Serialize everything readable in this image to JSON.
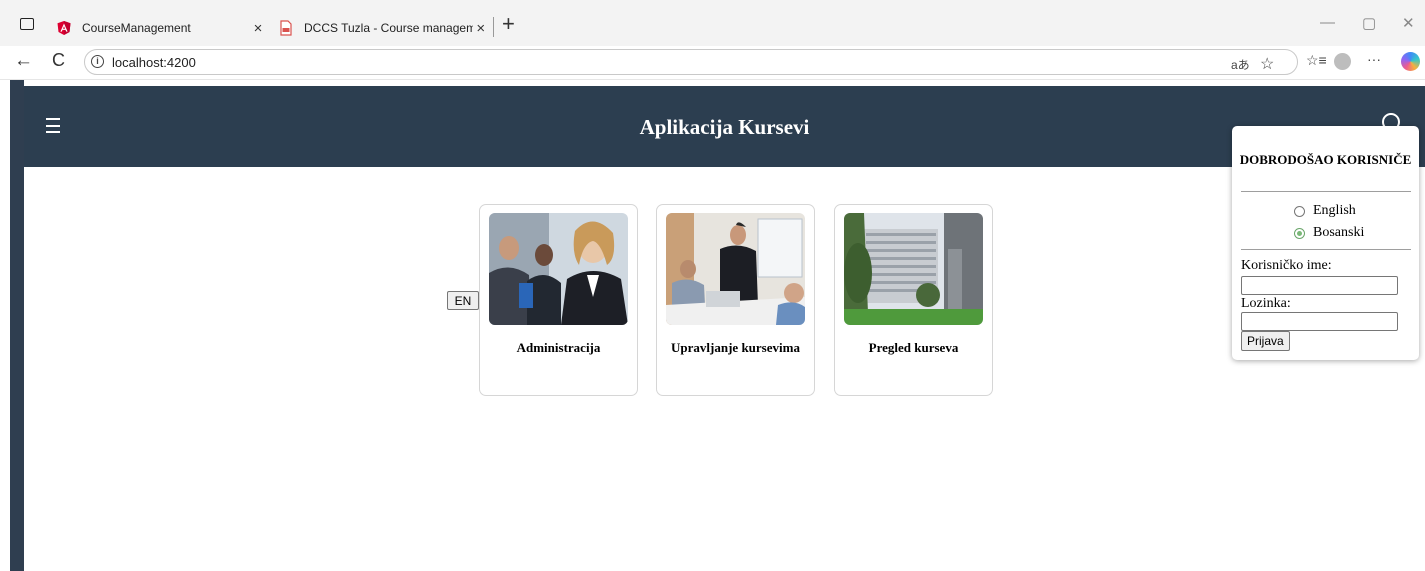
{
  "browser": {
    "tabs": [
      {
        "title": "CourseManagement",
        "active": true,
        "icon": "angular-icon",
        "close": "×"
      },
      {
        "title": "DCCS Tuzla - Course managemen",
        "active": false,
        "icon": "pdf-icon",
        "close": "×"
      }
    ],
    "new_tab": "+",
    "window_controls": [
      "—",
      "▢",
      "✕"
    ],
    "nav": {
      "back": "←",
      "reload": "C"
    },
    "address": "localhost:4200",
    "address_icons": {
      "read_aloud": "aあ",
      "favorite": "☆",
      "favorites": "☆≡",
      "more": "···"
    }
  },
  "app": {
    "title": "Aplikacija Kursevi",
    "lang_button": "EN",
    "header_bg": "#2c3e50",
    "cards": [
      {
        "label": "Administracija",
        "image": "business-team-photo"
      },
      {
        "label": "Upravljanje kursevima",
        "image": "office-meeting-photo"
      },
      {
        "label": "Pregled kurseva",
        "image": "campus-building-photo"
      }
    ]
  },
  "login": {
    "welcome": "DOBRODOŠAO KORISNIČE",
    "languages": [
      {
        "label": "English",
        "checked": false
      },
      {
        "label": "Bosanski",
        "checked": true
      }
    ],
    "username_label": "Korisničko ime:",
    "username_value": "",
    "password_label": "Lozinka:",
    "password_value": "",
    "submit": "Prijava"
  }
}
